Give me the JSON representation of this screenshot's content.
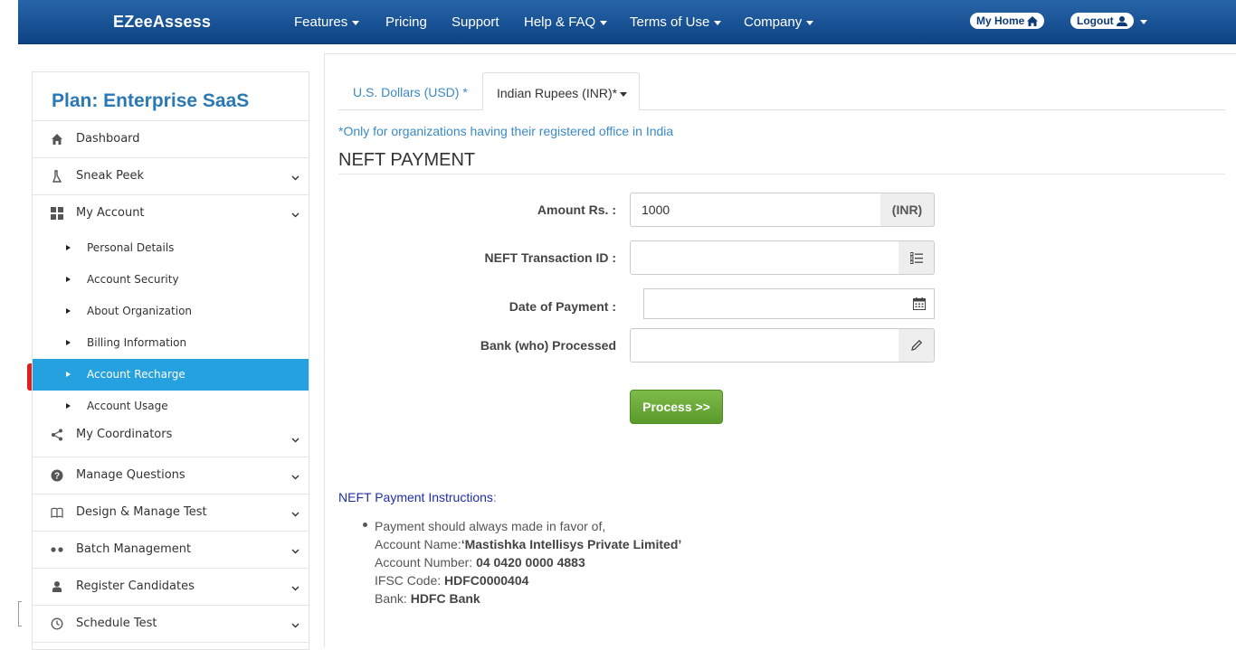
{
  "navbar": {
    "brand": "EZeeAssess",
    "items": [
      "Features",
      "Pricing",
      "Support",
      "Help & FAQ",
      "Terms of Use",
      "Company"
    ],
    "my_home": "My Home",
    "logout": "Logout"
  },
  "sidebar": {
    "plan_title": "Plan: Enterprise SaaS",
    "items": [
      {
        "label": "Dashboard",
        "icon": "home-icon"
      },
      {
        "label": "Sneak Peek",
        "icon": "flask-icon"
      },
      {
        "label": "My Account",
        "icon": "grid-icon"
      },
      {
        "label": "My Coordinators",
        "icon": "share-icon"
      },
      {
        "label": "Manage Questions",
        "icon": "question-icon"
      },
      {
        "label": "Design & Manage Test",
        "icon": "book-icon"
      },
      {
        "label": "Batch Management",
        "icon": "dots-icon"
      },
      {
        "label": "Register Candidates",
        "icon": "user-icon"
      },
      {
        "label": "Schedule Test",
        "icon": "clock-icon"
      }
    ],
    "sub_items": [
      "Personal Details",
      "Account Security",
      "About Organization",
      "Billing Information",
      "Account Recharge",
      "Account Usage"
    ],
    "active_sub_item": "Account Recharge"
  },
  "main": {
    "tabs": [
      "U.S. Dollars (USD) *",
      "Indian Rupees (INR)*"
    ],
    "active_tab": "Indian Rupees (INR)*",
    "note": "*Only for organizations having their registered office in India",
    "section_title": "NEFT PAYMENT",
    "form": {
      "amount_label": "Amount Rs. :",
      "amount_value": "1000",
      "amount_addon": "(INR)",
      "txn_label": "NEFT Transaction ID :",
      "txn_value": "",
      "date_label": "Date of Payment :",
      "date_value": "",
      "bank_label": "Bank (who) Processed",
      "bank_value": "",
      "process_button": "Process >>"
    },
    "instructions": {
      "title": "NEFT Payment Instructions",
      "title_suffix": ":",
      "line1": "Payment should always made in favor of,",
      "account_name_label": "Account Name:",
      "account_name": "‘Mastishka Intellisys Private Limited’",
      "account_number_label": "Account Number: ",
      "account_number": "04 0420 0000 4883",
      "ifsc_label": "IFSC Code: ",
      "ifsc": "HDFC0000404",
      "bank_label": "Bank: ",
      "bank": "HDFC Bank"
    }
  }
}
